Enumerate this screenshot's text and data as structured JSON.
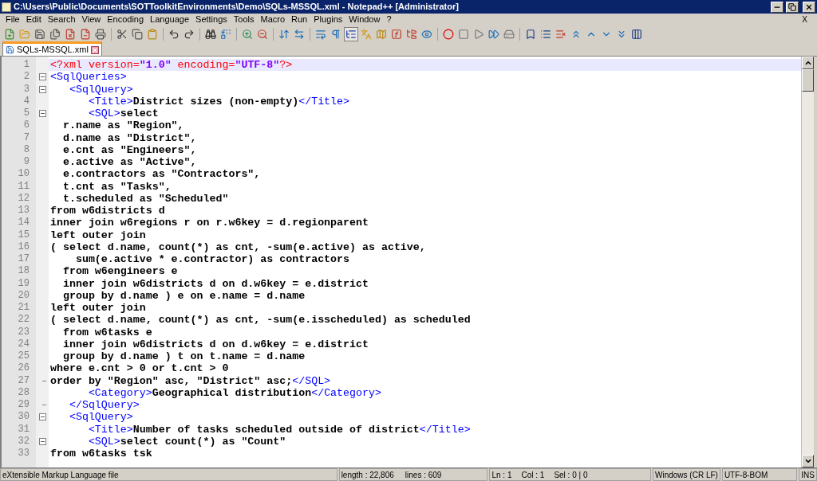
{
  "window": {
    "title": "C:\\Users\\Public\\Documents\\SOTToolkitEnvironments\\Demo\\SQLs-MSSQL.xml - Notepad++ [Administrator]"
  },
  "menu": [
    "File",
    "Edit",
    "Search",
    "View",
    "Encoding",
    "Language",
    "Settings",
    "Tools",
    "Macro",
    "Run",
    "Plugins",
    "Window",
    "?"
  ],
  "menu_close": "X",
  "toolbar": [
    {
      "kind": "new",
      "pressed": false
    },
    {
      "kind": "open",
      "pressed": false
    },
    {
      "kind": "save",
      "pressed": false
    },
    {
      "kind": "saveall",
      "pressed": false
    },
    {
      "kind": "close",
      "pressed": false
    },
    {
      "kind": "closeall",
      "pressed": false
    },
    {
      "kind": "print",
      "pressed": false
    },
    {
      "kind": "sep"
    },
    {
      "kind": "cut",
      "pressed": false
    },
    {
      "kind": "copy",
      "pressed": false
    },
    {
      "kind": "paste",
      "pressed": false
    },
    {
      "kind": "sep"
    },
    {
      "kind": "undo",
      "pressed": false
    },
    {
      "kind": "redo",
      "pressed": false
    },
    {
      "kind": "sep"
    },
    {
      "kind": "find",
      "pressed": false
    },
    {
      "kind": "replace",
      "pressed": false
    },
    {
      "kind": "sep"
    },
    {
      "kind": "zoomin",
      "pressed": false
    },
    {
      "kind": "zoomout",
      "pressed": false
    },
    {
      "kind": "sep"
    },
    {
      "kind": "syncv",
      "pressed": false
    },
    {
      "kind": "synch",
      "pressed": false
    },
    {
      "kind": "sep"
    },
    {
      "kind": "wrap",
      "pressed": false
    },
    {
      "kind": "allchars",
      "pressed": false
    },
    {
      "kind": "indent",
      "pressed": true
    },
    {
      "kind": "lang",
      "pressed": false
    },
    {
      "kind": "docmap",
      "pressed": false
    },
    {
      "kind": "funclist",
      "pressed": false
    },
    {
      "kind": "folder",
      "pressed": false
    },
    {
      "kind": "monitor",
      "pressed": false
    },
    {
      "kind": "sep"
    },
    {
      "kind": "record",
      "pressed": false
    },
    {
      "kind": "stop",
      "pressed": false
    },
    {
      "kind": "play",
      "pressed": false
    },
    {
      "kind": "playmulti",
      "pressed": false
    },
    {
      "kind": "savemacro",
      "pressed": false
    },
    {
      "kind": "sep"
    },
    {
      "kind": "bookmark",
      "pressed": false
    },
    {
      "kind": "list",
      "pressed": false
    },
    {
      "kind": "listx",
      "pressed": false
    },
    {
      "kind": "first",
      "pressed": false
    },
    {
      "kind": "up",
      "pressed": false
    },
    {
      "kind": "down",
      "pressed": false
    },
    {
      "kind": "last",
      "pressed": false
    },
    {
      "kind": "columns",
      "pressed": false
    }
  ],
  "tabs": [
    {
      "label": "SQLs-MSSQL.xml",
      "selected": true
    }
  ],
  "editor": {
    "lines": [
      {
        "number": "1",
        "current": true,
        "fold_start": false,
        "fold_end": false,
        "segments": [
          {
            "kind": "decl",
            "text": "<?xml version="
          },
          {
            "kind": "value",
            "text": "\"1.0\""
          },
          {
            "kind": "decl",
            "text": " encoding="
          },
          {
            "kind": "value",
            "text": "\"UTF-8\""
          },
          {
            "kind": "decl",
            "text": "?>"
          }
        ]
      },
      {
        "number": "2",
        "current": false,
        "fold_start": true,
        "fold_end": false,
        "segments": [
          {
            "kind": "tag",
            "text": "<SqlQueries>"
          }
        ]
      },
      {
        "number": "3",
        "current": false,
        "fold_start": true,
        "fold_end": false,
        "segments": [
          {
            "kind": "tag",
            "text": "   <SqlQuery>"
          }
        ]
      },
      {
        "number": "4",
        "current": false,
        "fold_start": false,
        "fold_end": false,
        "segments": [
          {
            "kind": "tag",
            "text": "      <Title>"
          },
          {
            "kind": "text",
            "text": "District sizes (non-empty)"
          },
          {
            "kind": "tag",
            "text": "</Title>"
          }
        ]
      },
      {
        "number": "5",
        "current": false,
        "fold_start": true,
        "fold_end": false,
        "segments": [
          {
            "kind": "tag",
            "text": "      <SQL>"
          },
          {
            "kind": "text",
            "text": "select"
          }
        ]
      },
      {
        "number": "6",
        "current": false,
        "fold_start": false,
        "fold_end": false,
        "segments": [
          {
            "kind": "text",
            "text": "  r.name as \"Region\","
          }
        ]
      },
      {
        "number": "7",
        "current": false,
        "fold_start": false,
        "fold_end": false,
        "segments": [
          {
            "kind": "text",
            "text": "  d.name as \"District\","
          }
        ]
      },
      {
        "number": "8",
        "current": false,
        "fold_start": false,
        "fold_end": false,
        "segments": [
          {
            "kind": "text",
            "text": "  e.cnt as \"Engineers\","
          }
        ]
      },
      {
        "number": "9",
        "current": false,
        "fold_start": false,
        "fold_end": false,
        "segments": [
          {
            "kind": "text",
            "text": "  e.active as \"Active\","
          }
        ]
      },
      {
        "number": "10",
        "current": false,
        "fold_start": false,
        "fold_end": false,
        "segments": [
          {
            "kind": "text",
            "text": "  e.contractors as \"Contractors\","
          }
        ]
      },
      {
        "number": "11",
        "current": false,
        "fold_start": false,
        "fold_end": false,
        "segments": [
          {
            "kind": "text",
            "text": "  t.cnt as \"Tasks\","
          }
        ]
      },
      {
        "number": "12",
        "current": false,
        "fold_start": false,
        "fold_end": false,
        "segments": [
          {
            "kind": "text",
            "text": "  t.scheduled as \"Scheduled\""
          }
        ]
      },
      {
        "number": "13",
        "current": false,
        "fold_start": false,
        "fold_end": false,
        "segments": [
          {
            "kind": "text",
            "text": "from w6districts d"
          }
        ]
      },
      {
        "number": "14",
        "current": false,
        "fold_start": false,
        "fold_end": false,
        "segments": [
          {
            "kind": "text",
            "text": "inner join w6regions r on r.w6key = d.regionparent"
          }
        ]
      },
      {
        "number": "15",
        "current": false,
        "fold_start": false,
        "fold_end": false,
        "segments": [
          {
            "kind": "text",
            "text": "left outer join"
          }
        ]
      },
      {
        "number": "16",
        "current": false,
        "fold_start": false,
        "fold_end": false,
        "segments": [
          {
            "kind": "text",
            "text": "( select d.name, count(*) as cnt, -sum(e.active) as active,"
          }
        ]
      },
      {
        "number": "17",
        "current": false,
        "fold_start": false,
        "fold_end": false,
        "segments": [
          {
            "kind": "text",
            "text": "    sum(e.active * e.contractor) as contractors"
          }
        ]
      },
      {
        "number": "18",
        "current": false,
        "fold_start": false,
        "fold_end": false,
        "segments": [
          {
            "kind": "text",
            "text": "  from w6engineers e"
          }
        ]
      },
      {
        "number": "19",
        "current": false,
        "fold_start": false,
        "fold_end": false,
        "segments": [
          {
            "kind": "text",
            "text": "  inner join w6districts d on d.w6key = e.district"
          }
        ]
      },
      {
        "number": "20",
        "current": false,
        "fold_start": false,
        "fold_end": false,
        "segments": [
          {
            "kind": "text",
            "text": "  group by d.name ) e on e.name = d.name"
          }
        ]
      },
      {
        "number": "21",
        "current": false,
        "fold_start": false,
        "fold_end": false,
        "segments": [
          {
            "kind": "text",
            "text": "left outer join"
          }
        ]
      },
      {
        "number": "22",
        "current": false,
        "fold_start": false,
        "fold_end": false,
        "segments": [
          {
            "kind": "text",
            "text": "( select d.name, count(*) as cnt, -sum(e.isscheduled) as scheduled"
          }
        ]
      },
      {
        "number": "23",
        "current": false,
        "fold_start": false,
        "fold_end": false,
        "segments": [
          {
            "kind": "text",
            "text": "  from w6tasks e"
          }
        ]
      },
      {
        "number": "24",
        "current": false,
        "fold_start": false,
        "fold_end": false,
        "segments": [
          {
            "kind": "text",
            "text": "  inner join w6districts d on d.w6key = e.district"
          }
        ]
      },
      {
        "number": "25",
        "current": false,
        "fold_start": false,
        "fold_end": false,
        "segments": [
          {
            "kind": "text",
            "text": "  group by d.name ) t on t.name = d.name"
          }
        ]
      },
      {
        "number": "26",
        "current": false,
        "fold_start": false,
        "fold_end": false,
        "segments": [
          {
            "kind": "text",
            "text": "where e.cnt > 0 or t.cnt > 0"
          }
        ]
      },
      {
        "number": "27",
        "current": false,
        "fold_start": false,
        "fold_end": true,
        "segments": [
          {
            "kind": "text",
            "text": "order by \"Region\" asc, \"District\" asc;"
          },
          {
            "kind": "tag",
            "text": "</SQL>"
          }
        ]
      },
      {
        "number": "28",
        "current": false,
        "fold_start": false,
        "fold_end": false,
        "segments": [
          {
            "kind": "tag",
            "text": "      <Category>"
          },
          {
            "kind": "text",
            "text": "Geographical distribution"
          },
          {
            "kind": "tag",
            "text": "</Category>"
          }
        ]
      },
      {
        "number": "29",
        "current": false,
        "fold_start": false,
        "fold_end": true,
        "segments": [
          {
            "kind": "tag",
            "text": "   </SqlQuery>"
          }
        ]
      },
      {
        "number": "30",
        "current": false,
        "fold_start": true,
        "fold_end": false,
        "segments": [
          {
            "kind": "tag",
            "text": "   <SqlQuery>"
          }
        ]
      },
      {
        "number": "31",
        "current": false,
        "fold_start": false,
        "fold_end": false,
        "segments": [
          {
            "kind": "tag",
            "text": "      <Title>"
          },
          {
            "kind": "text",
            "text": "Number of tasks scheduled outside of district"
          },
          {
            "kind": "tag",
            "text": "</Title>"
          }
        ]
      },
      {
        "number": "32",
        "current": false,
        "fold_start": true,
        "fold_end": false,
        "segments": [
          {
            "kind": "tag",
            "text": "      <SQL>"
          },
          {
            "kind": "text",
            "text": "select count(*) as \"Count\""
          }
        ]
      },
      {
        "number": "33",
        "current": false,
        "fold_start": false,
        "fold_end": false,
        "segments": [
          {
            "kind": "text",
            "text": "from w6tasks tsk"
          }
        ]
      }
    ]
  },
  "status_bar": {
    "file_type": "eXtensible Markup Language file",
    "length": "length : 22,806",
    "lines": "lines : 609",
    "ln": "Ln : 1",
    "col": "Col : 1",
    "sel": "Sel : 0 | 0",
    "eol": "Windows (CR LF)",
    "encoding": "UTF-8-BOM",
    "mode": "INS"
  }
}
